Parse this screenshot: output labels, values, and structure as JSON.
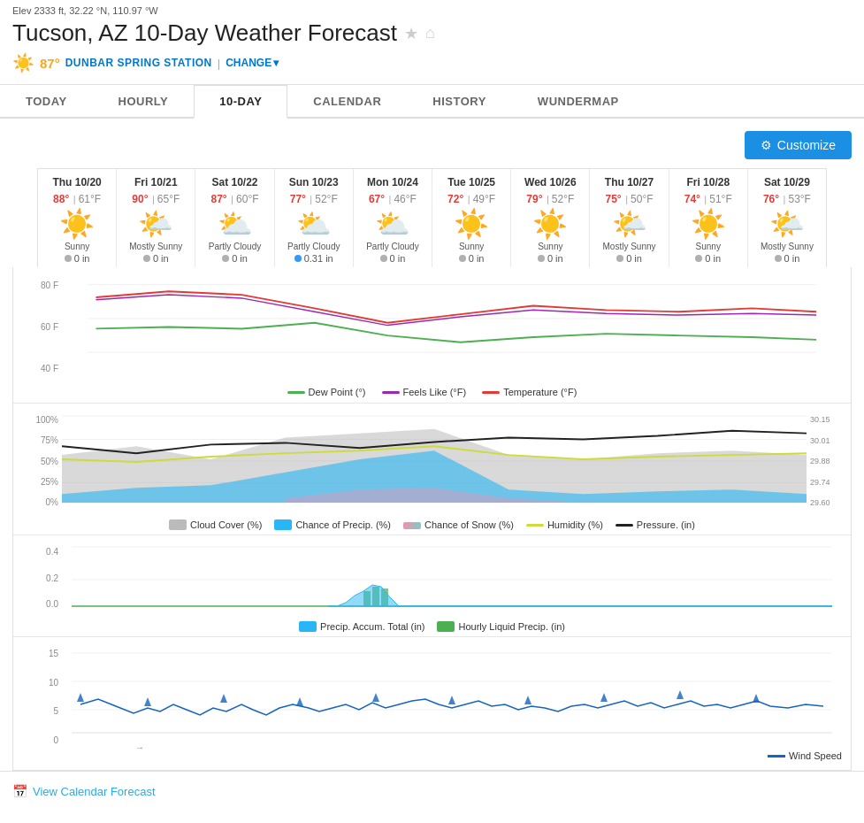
{
  "meta": {
    "elev": "Elev 2333 ft, 32.22 °N, 110.97 °W",
    "title": "Tucson, AZ 10-Day Weather Forecast",
    "temp": "87°",
    "station": "DUNBAR SPRING STATION",
    "change": "CHANGE"
  },
  "tabs": [
    {
      "id": "today",
      "label": "TODAY",
      "active": false
    },
    {
      "id": "hourly",
      "label": "HOURLY",
      "active": false
    },
    {
      "id": "10-day",
      "label": "10-DAY",
      "active": true
    },
    {
      "id": "calendar",
      "label": "CALENDAR",
      "active": false
    },
    {
      "id": "history",
      "label": "HISTORY",
      "active": false
    },
    {
      "id": "wundermap",
      "label": "WUNDERMAP",
      "active": false
    }
  ],
  "toolbar": {
    "customize_label": "Customize"
  },
  "days": [
    {
      "date": "Thu 10/20",
      "high": "88°",
      "low": "61°F",
      "condition": "Sunny",
      "icon": "☀️",
      "precip": "0 in",
      "precip_type": "none"
    },
    {
      "date": "Fri 10/21",
      "high": "90°",
      "low": "65°F",
      "condition": "Mostly Sunny",
      "icon": "🌤️",
      "precip": "0 in",
      "precip_type": "none"
    },
    {
      "date": "Sat 10/22",
      "high": "87°",
      "low": "60°F",
      "condition": "Partly Cloudy",
      "icon": "⛅",
      "precip": "0 in",
      "precip_type": "none"
    },
    {
      "date": "Sun 10/23",
      "high": "77°",
      "low": "52°F",
      "condition": "Partly Cloudy",
      "icon": "⛅",
      "precip": "0.31 in",
      "precip_type": "rain"
    },
    {
      "date": "Mon 10/24",
      "high": "67°",
      "low": "46°F",
      "condition": "Partly Cloudy",
      "icon": "⛅",
      "precip": "0 in",
      "precip_type": "none"
    },
    {
      "date": "Tue 10/25",
      "high": "72°",
      "low": "49°F",
      "condition": "Sunny",
      "icon": "☀️",
      "precip": "0 in",
      "precip_type": "none"
    },
    {
      "date": "Wed 10/26",
      "high": "79°",
      "low": "52°F",
      "condition": "Sunny",
      "icon": "☀️",
      "precip": "0 in",
      "precip_type": "none"
    },
    {
      "date": "Thu 10/27",
      "high": "75°",
      "low": "50°F",
      "condition": "Mostly Sunny",
      "icon": "🌤️",
      "precip": "0 in",
      "precip_type": "none"
    },
    {
      "date": "Fri 10/28",
      "high": "74°",
      "low": "51°F",
      "condition": "Sunny",
      "icon": "☀️",
      "precip": "0 in",
      "precip_type": "none"
    },
    {
      "date": "Sat 10/29",
      "high": "76°",
      "low": "53°F",
      "condition": "Mostly Sunny",
      "icon": "🌤️",
      "precip": "0 in",
      "precip_type": "none"
    }
  ],
  "legend_temp": [
    {
      "label": "Dew Point (°)",
      "color": "#4caf50"
    },
    {
      "label": "Feels Like (°F)",
      "color": "#9c27b0"
    },
    {
      "label": "Temperature (°F)",
      "color": "#e53935"
    }
  ],
  "legend_humid": [
    {
      "label": "Cloud Cover (%)",
      "color": "#bbb"
    },
    {
      "label": "Chance of Precip. (%)",
      "color": "#29b6f6"
    },
    {
      "label": "Chance of Snow (%)",
      "color": "#f48fb1"
    },
    {
      "label": "Humidity (%)",
      "color": "#cddc39"
    },
    {
      "label": "Pressure. (in)",
      "color": "#222"
    }
  ],
  "legend_precip": [
    {
      "label": "Precip. Accum. Total (in)",
      "color": "#29b6f6"
    },
    {
      "label": "Hourly Liquid Precip. (in)",
      "color": "#4caf50"
    }
  ],
  "legend_wind": [
    {
      "label": "Wind Speed",
      "color": "#1565c0"
    }
  ],
  "bottom": {
    "calendar_link": "View Calendar Forecast"
  }
}
